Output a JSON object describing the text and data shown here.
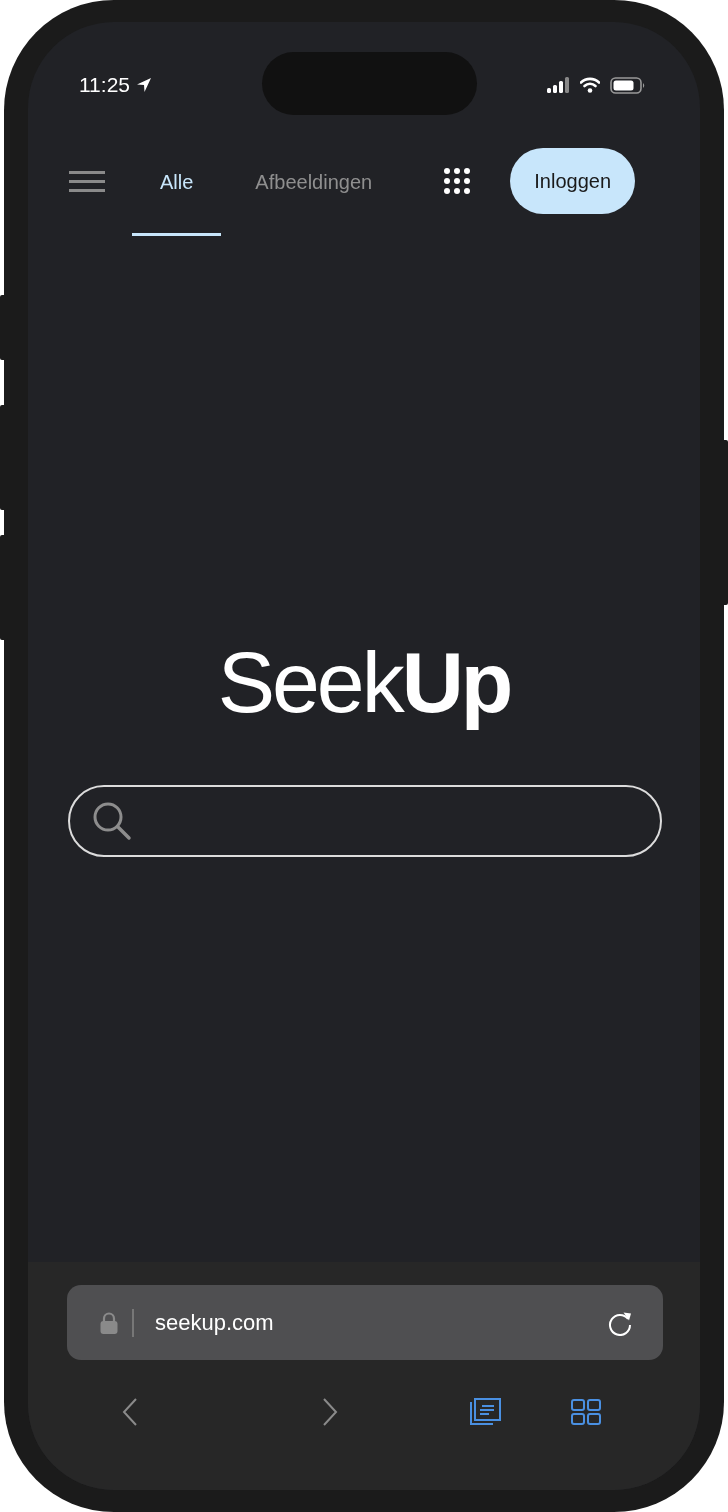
{
  "status_bar": {
    "time": "11:25"
  },
  "nav": {
    "tabs": [
      {
        "label": "Alle",
        "selected": true
      },
      {
        "label": "Afbeeldingen",
        "selected": false
      }
    ],
    "login_button": "Inloggen"
  },
  "logo": "Seek**Up**",
  "address_bar": {
    "url": "seekup.com"
  }
}
